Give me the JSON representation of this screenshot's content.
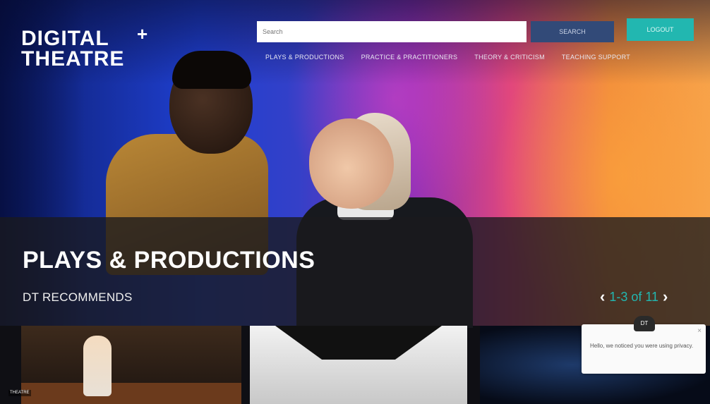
{
  "brand": {
    "logo_line1": "DIGITAL",
    "logo_line2": "THEATRE",
    "logo_plus": "+"
  },
  "search": {
    "placeholder": "Search",
    "button_label": "SEARCH"
  },
  "header": {
    "logout_label": "LOGOUT"
  },
  "nav": {
    "items": [
      {
        "label": "PLAYS & PRODUCTIONS"
      },
      {
        "label": "PRACTICE & PRACTITIONERS"
      },
      {
        "label": "THEORY & CRITICISM"
      },
      {
        "label": "TEACHING SUPPORT"
      }
    ]
  },
  "main": {
    "section_title": "PLAYS & PRODUCTIONS",
    "subsection_title": "DT RECOMMENDS",
    "pager": {
      "prev_icon": "‹",
      "label": "1-3 of 11",
      "next_icon": "›"
    }
  },
  "cards": [
    {
      "tag": "THEATRE"
    },
    {},
    {}
  ],
  "popup": {
    "badge": "DT",
    "text": "Hello, we noticed you were using privacy.",
    "close": "×"
  },
  "colors": {
    "accent_teal": "#22b7b0",
    "search_button": "#324a78",
    "band": "#191a1e"
  }
}
